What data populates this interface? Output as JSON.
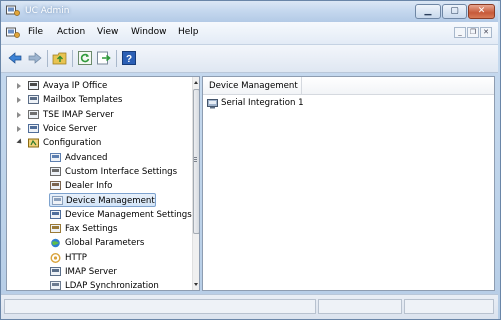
{
  "window": {
    "title": "UC Admin",
    "title_bar_color": "#c4d7ee",
    "caption_buttons": [
      "minimize",
      "maximize",
      "close"
    ]
  },
  "menu": {
    "items": [
      "File",
      "Action",
      "View",
      "Window",
      "Help"
    ],
    "inner_controls": [
      "minimize",
      "restore",
      "close"
    ]
  },
  "toolbar": {
    "buttons": [
      "back-arrow-icon",
      "forward-arrow-icon",
      "up-folder-icon",
      "refresh-icon",
      "export-icon",
      "help-icon"
    ]
  },
  "tree": {
    "items": [
      {
        "label": "Avaya IP Office",
        "icon": "server-icon",
        "level": 0,
        "expander": "closed"
      },
      {
        "label": "Mailbox Templates",
        "icon": "mailbox-templates-icon",
        "level": 0,
        "expander": "closed"
      },
      {
        "label": "TSE IMAP Server",
        "icon": "imap-server-icon",
        "level": 0,
        "expander": "closed"
      },
      {
        "label": "Voice Server",
        "icon": "voice-server-icon",
        "level": 0,
        "expander": "closed"
      },
      {
        "label": "Configuration",
        "icon": "configuration-icon",
        "level": 0,
        "expander": "open"
      },
      {
        "label": "Advanced",
        "icon": "advanced-icon",
        "level": 1
      },
      {
        "label": "Custom Interface Settings",
        "icon": "custom-interface-icon",
        "level": 1
      },
      {
        "label": "Dealer Info",
        "icon": "dealer-info-icon",
        "level": 1
      },
      {
        "label": "Device Management",
        "icon": "device-management-icon",
        "level": 1,
        "selected": true
      },
      {
        "label": "Device Management Settings",
        "icon": "device-settings-icon",
        "level": 1
      },
      {
        "label": "Fax Settings",
        "icon": "fax-icon",
        "level": 1
      },
      {
        "label": "Global Parameters",
        "icon": "globe-icon",
        "level": 1
      },
      {
        "label": "HTTP",
        "icon": "http-icon",
        "level": 1
      },
      {
        "label": "IMAP Server",
        "icon": "imap-icon",
        "level": 1
      },
      {
        "label": "LDAP Synchronization",
        "icon": "ldap-icon",
        "level": 1
      }
    ]
  },
  "details": {
    "column_header": "Device Management",
    "rows": [
      {
        "label": "Serial Integration 1",
        "icon": "serial-integration-icon"
      }
    ]
  }
}
